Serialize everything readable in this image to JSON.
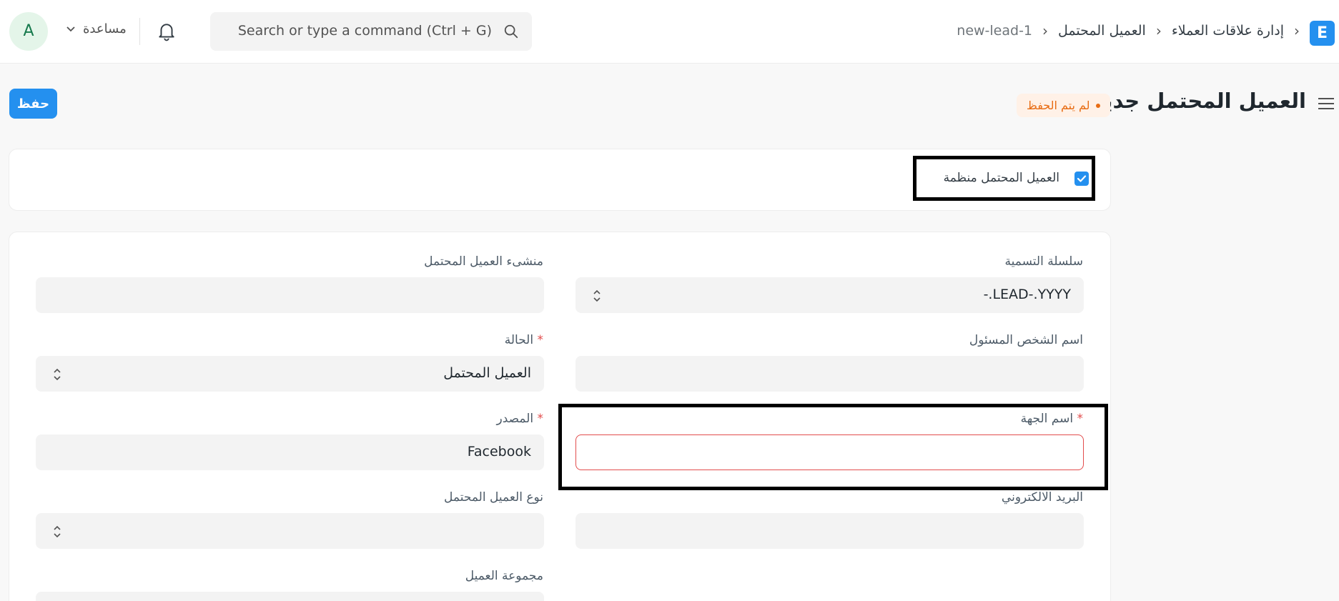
{
  "navbar": {
    "logo_letter": "E",
    "breadcrumbs": [
      "إدارة علاقات العملاء",
      "العميل المحتمل",
      "new-lead-1"
    ],
    "search_placeholder": "Search or type a command (Ctrl + G)",
    "help_label": "مساعدة",
    "avatar_initial": "A"
  },
  "page": {
    "title": "العميل المحتمل جديد",
    "status_indicator": "لم يتم الحفظ",
    "save_label": "حفظ"
  },
  "org_section": {
    "checkbox_label": "العميل المحتمل منظمة",
    "checked": true
  },
  "form": {
    "naming_series": {
      "label": "سلسلة التسمية",
      "value": "-.LEAD-.YYYY"
    },
    "lead_owner": {
      "label": "منشىء العميل المحتمل",
      "value": ""
    },
    "contact_person": {
      "label": "اسم الشخص المسئول",
      "value": ""
    },
    "status": {
      "label": "الحالة",
      "required_mark": "*",
      "value": "العميل المحتمل"
    },
    "organization_name": {
      "label": "اسم الجهة",
      "required_mark": "*",
      "value": ""
    },
    "source": {
      "label": "المصدر",
      "required_mark": "*",
      "value": "Facebook"
    },
    "email": {
      "label": "البريد الالكتروني",
      "value": ""
    },
    "lead_type": {
      "label": "نوع العميل المحتمل",
      "value": ""
    },
    "customer_group": {
      "label": "مجموعة العميل",
      "value": ""
    }
  },
  "colors": {
    "primary": "#2490ef",
    "warning": "#e86c13",
    "error": "#e24c4c"
  }
}
